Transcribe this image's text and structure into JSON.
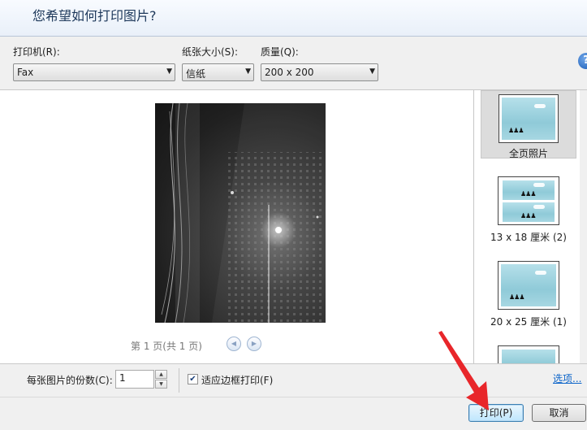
{
  "dialog": {
    "title": "您希望如何打印图片?"
  },
  "printer": {
    "label": "打印机(R):",
    "value": "Fax"
  },
  "paper_size": {
    "label": "纸张大小(S):",
    "value": "信纸"
  },
  "quality": {
    "label": "质量(Q):",
    "value": "200 x 200"
  },
  "help": {
    "icon": "help-icon",
    "glyph": "?"
  },
  "preview": {
    "page_indicator": "第 1 页(共 1 页)",
    "prev_glyph": "◀",
    "next_glyph": "▶"
  },
  "layouts": [
    {
      "label": "全页照片",
      "selected": true
    },
    {
      "label": "13 x 18 厘米 (2)",
      "selected": false
    },
    {
      "label": "20 x 25 厘米 (1)",
      "selected": false
    },
    {
      "label": "",
      "selected": false
    }
  ],
  "copies": {
    "label": "每张图片的份数(C):",
    "value": "1",
    "up_glyph": "▲",
    "down_glyph": "▼"
  },
  "fit": {
    "label": "适应边框打印(F)",
    "checked": true,
    "check_glyph": "✔"
  },
  "options_link": "选项...",
  "buttons": {
    "print": "打印(P)",
    "cancel": "取消"
  },
  "colors": {
    "accent_arrow": "#e8262a",
    "link": "#0a63c9",
    "title": "#1e395b"
  }
}
